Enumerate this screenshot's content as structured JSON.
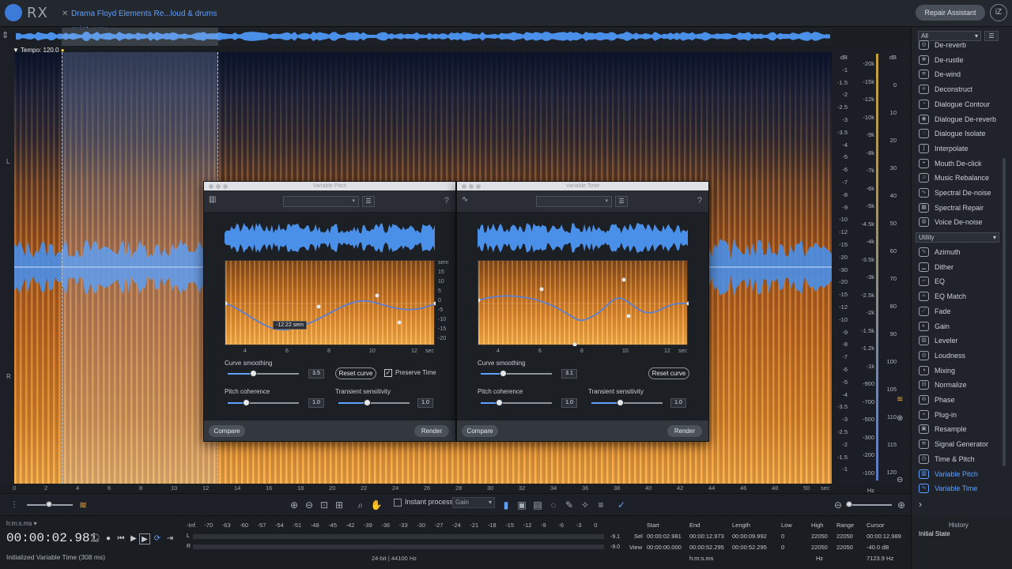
{
  "app": {
    "logo_text": "RX",
    "repair_assistant": "Repair Assistant",
    "brand_badge": "iZ"
  },
  "tab": {
    "title": "Drama Floyd Elements Re...loud & drums quiet .wav",
    "close": "✕"
  },
  "spectrogram": {
    "tempo": "Tempo: 120.0",
    "channel_l": "L",
    "channel_r": "R",
    "time_axis": [
      "0",
      "2",
      "4",
      "6",
      "8",
      "10",
      "12",
      "14",
      "16",
      "18",
      "20",
      "22",
      "24",
      "26",
      "28",
      "30",
      "32",
      "34",
      "36",
      "38",
      "40",
      "42",
      "44",
      "46",
      "48",
      "50",
      "sec"
    ],
    "db_scale": [
      "dB",
      "-1",
      "-1.5",
      "-2",
      "-2.5",
      "-3",
      "-3.5",
      "-4",
      "-5",
      "-6",
      "-7",
      "-8",
      "-9",
      "-10",
      "-12",
      "-15",
      "-20",
      "-30",
      "-20",
      "-15",
      "-12",
      "-10",
      "-9",
      "-8",
      "-7",
      "-6",
      "-5",
      "-4",
      "-3.5",
      "-3",
      "-2.5",
      "-2",
      "-1.5",
      "-1"
    ],
    "freq_scale": [
      "-20k",
      "-15k",
      "-12k",
      "-10k",
      "-9k",
      "-8k",
      "-7k",
      "-6k",
      "-5k",
      "-4.5k",
      "-4k",
      "-3.5k",
      "-3k",
      "-2.5k",
      "-2k",
      "-1.5k",
      "-1.2k",
      "-1k",
      "-900",
      "-700",
      "-500",
      "-300",
      "-200",
      "-100",
      "Hz"
    ],
    "level_scale": [
      "dB",
      "0",
      "10",
      "20",
      "30",
      "40",
      "50",
      "60",
      "70",
      "80",
      "90",
      "100",
      "105",
      "110",
      "115",
      "120"
    ]
  },
  "toolbar": {
    "instant_process": "Instant process",
    "gain_mode": "Gain"
  },
  "transport": {
    "time_format": "h:m:s.ms",
    "timecode": "00:00:02.981",
    "status": "Initialized Variable Time (308 ms)",
    "format": "24-bit | 44100 Hz",
    "meter_scale": [
      "-Inf.",
      "-70",
      "-63",
      "-60",
      "-57",
      "-54",
      "-51",
      "-48",
      "-45",
      "-42",
      "-39",
      "-36",
      "-33",
      "-30",
      "-27",
      "-24",
      "-21",
      "-18",
      "-15",
      "-12",
      "-9",
      "-6",
      "-3",
      "0"
    ],
    "meter_l": "L",
    "meter_r": "R",
    "readout_l": "-9.1",
    "readout_r": "-9.0"
  },
  "selection_info": {
    "headers": {
      "start": "Start",
      "end": "End",
      "length": "Length",
      "low": "Low",
      "high": "High",
      "range": "Range",
      "cursor": "Cursor"
    },
    "sel": {
      "label": "Sel",
      "start": "00:00:02.981",
      "end": "00:00:12.973",
      "length": "00:00:09.992",
      "low": "0",
      "high": "22050",
      "range": "22050",
      "cursor": "00:00:12.989"
    },
    "view": {
      "label": "View",
      "start": "00:00:00.000",
      "end": "00:00:52.295",
      "length": "00:00:52.295",
      "low": "0",
      "high": "22050",
      "range": "22050",
      "cursor": "-40.0 dB"
    },
    "units_time": "h:m:s.ms",
    "units_hz": "Hz",
    "cursor_hz": "7123.9 Hz"
  },
  "module_panel": {
    "filter": "All",
    "modules": [
      {
        "name": "De-reverb",
        "icon": "de-reverb-icon",
        "glyph": "◎"
      },
      {
        "name": "De-rustle",
        "icon": "de-rustle-icon",
        "glyph": "❀"
      },
      {
        "name": "De-wind",
        "icon": "de-wind-icon",
        "glyph": "≋"
      },
      {
        "name": "Deconstruct",
        "icon": "deconstruct-icon",
        "glyph": "⟡"
      },
      {
        "name": "Dialogue Contour",
        "icon": "dialogue-contour-icon",
        "glyph": "◔"
      },
      {
        "name": "Dialogue De-reverb",
        "icon": "dialogue-de-reverb-icon",
        "glyph": "◉"
      },
      {
        "name": "Dialogue Isolate",
        "icon": "dialogue-isolate-icon",
        "glyph": "◌"
      },
      {
        "name": "Interpolate",
        "icon": "interpolate-icon",
        "glyph": "ʃ"
      },
      {
        "name": "Mouth De-click",
        "icon": "mouth-de-click-icon",
        "glyph": "◓"
      },
      {
        "name": "Music Rebalance",
        "icon": "music-rebalance-icon",
        "glyph": "♫"
      },
      {
        "name": "Spectral De-noise",
        "icon": "spectral-de-noise-icon",
        "glyph": "∿"
      },
      {
        "name": "Spectral Repair",
        "icon": "spectral-repair-icon",
        "glyph": "▦"
      },
      {
        "name": "Voice De-noise",
        "icon": "voice-de-noise-icon",
        "glyph": "◍"
      }
    ],
    "utility_label": "Utility",
    "utilities": [
      {
        "name": "Azimuth",
        "icon": "azimuth-icon",
        "glyph": "∿"
      },
      {
        "name": "Dither",
        "icon": "dither-icon",
        "glyph": "▁"
      },
      {
        "name": "EQ",
        "icon": "eq-icon",
        "glyph": "∽"
      },
      {
        "name": "EQ Match",
        "icon": "eq-match-icon",
        "glyph": "≈"
      },
      {
        "name": "Fade",
        "icon": "fade-icon",
        "glyph": "⟋"
      },
      {
        "name": "Gain",
        "icon": "gain-icon",
        "glyph": "◐"
      },
      {
        "name": "Leveler",
        "icon": "leveler-icon",
        "glyph": "▥"
      },
      {
        "name": "Loudness",
        "icon": "loudness-icon",
        "glyph": "◎"
      },
      {
        "name": "Mixing",
        "icon": "mixing-icon",
        "glyph": "◑"
      },
      {
        "name": "Normalize",
        "icon": "normalize-icon",
        "glyph": "⊟"
      },
      {
        "name": "Phase",
        "icon": "phase-icon",
        "glyph": "⊘"
      },
      {
        "name": "Plug-in",
        "icon": "plug-in-icon",
        "glyph": "⌁"
      },
      {
        "name": "Resample",
        "icon": "resample-icon",
        "glyph": "▣"
      },
      {
        "name": "Signal Generator",
        "icon": "signal-generator-icon",
        "glyph": "≋"
      },
      {
        "name": "Time & Pitch",
        "icon": "time-pitch-icon",
        "glyph": "◷"
      },
      {
        "name": "Variable Pitch",
        "icon": "variable-pitch-icon",
        "glyph": "▥",
        "active": true
      },
      {
        "name": "Variable Time",
        "icon": "variable-time-icon",
        "glyph": "∿",
        "active": true
      }
    ],
    "more": "›"
  },
  "history": {
    "title": "History",
    "item": "Initial State"
  },
  "variable_pitch": {
    "title": "Variable Pitch",
    "x_ticks": [
      "4",
      "6",
      "8",
      "10",
      "12",
      "sec"
    ],
    "y_ticks": [
      "sem",
      "15",
      "10",
      "5",
      "0",
      "-5",
      "-10",
      "-15",
      "-20"
    ],
    "tooltip": "-12.22 sem",
    "curve_smoothing_label": "Curve smoothing",
    "curve_smoothing": 3.5,
    "curve_smoothing_text": "3.5",
    "reset_curve": "Reset curve",
    "preserve_time": "Preserve Time",
    "preserve_time_checked": true,
    "pitch_coherence_label": "Pitch coherence",
    "pitch_coherence": 1.0,
    "pitch_coherence_text": "1.0",
    "transient_label": "Transient sensitivity",
    "transient": 1.0,
    "transient_text": "1.0",
    "compare": "Compare",
    "render": "Render"
  },
  "variable_time": {
    "title": "Variable Time",
    "x_ticks": [
      "4",
      "6",
      "8",
      "10",
      "12",
      "sec"
    ],
    "curve_smoothing_label": "Curve smoothing",
    "curve_smoothing": 3.1,
    "curve_smoothing_text": "3.1",
    "reset_curve": "Reset curve",
    "pitch_coherence_label": "Pitch coherence",
    "pitch_coherence": 1.0,
    "pitch_coherence_text": "1.0",
    "transient_label": "Transient sensitivity",
    "transient": 1.0,
    "transient_text": "1.0",
    "compare": "Compare",
    "render": "Render"
  },
  "colors": {
    "accent": "#5fa0ff",
    "spectrum_hot": "#f09a38",
    "waveform": "#4a8fe8"
  }
}
